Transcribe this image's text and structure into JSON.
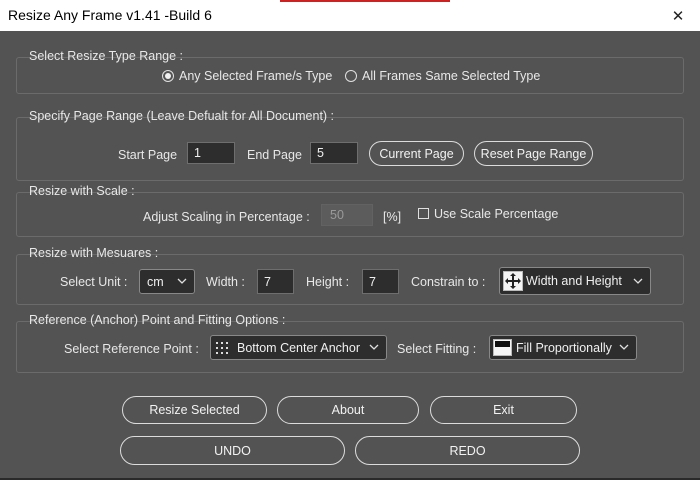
{
  "window": {
    "title": "Resize Any Frame v1.41 -Build 6",
    "close_glyph": "✕"
  },
  "resize_type": {
    "title": "Select Resize Type Range :",
    "options": [
      {
        "label": "Any Selected Frame/s Type",
        "checked": true
      },
      {
        "label": "All Frames Same Selected Type",
        "checked": false
      }
    ]
  },
  "page_range": {
    "title": "Specify Page Range (Leave Defualt for All Document) :",
    "start_label": "Start Page",
    "start_value": "1",
    "end_label": "End Page",
    "end_value": "5",
    "current_page_button": "Current Page",
    "reset_button": "Reset Page Range"
  },
  "scale": {
    "title": "Resize with Scale :",
    "adjust_label": "Adjust Scaling in Percentage :",
    "value": "50",
    "unit": "[%]",
    "use_scale_label": "Use Scale Percentage",
    "use_scale_checked": false
  },
  "measures": {
    "title": "Resize with Mesuares :",
    "unit_label": "Select Unit :",
    "unit_value": "cm",
    "width_label": "Width :",
    "width_value": "7",
    "height_label": "Height :",
    "height_value": "7",
    "constrain_label": "Constrain to :",
    "constrain_value": "Width and Height",
    "constrain_icon": "arrows-move-icon"
  },
  "reference": {
    "title": "Reference (Anchor) Point and Fitting Options :",
    "ref_label": "Select Reference Point :",
    "ref_value": "Bottom Center Anchor",
    "ref_icon": "anchor-grid-icon",
    "fitting_label": "Select Fitting :",
    "fitting_value": "Fill Proportionally",
    "fitting_icon": "fill-frame-icon"
  },
  "buttons": {
    "resize_selected": "Resize Selected",
    "about": "About",
    "exit": "Exit",
    "undo": "UNDO",
    "redo": "REDO"
  }
}
